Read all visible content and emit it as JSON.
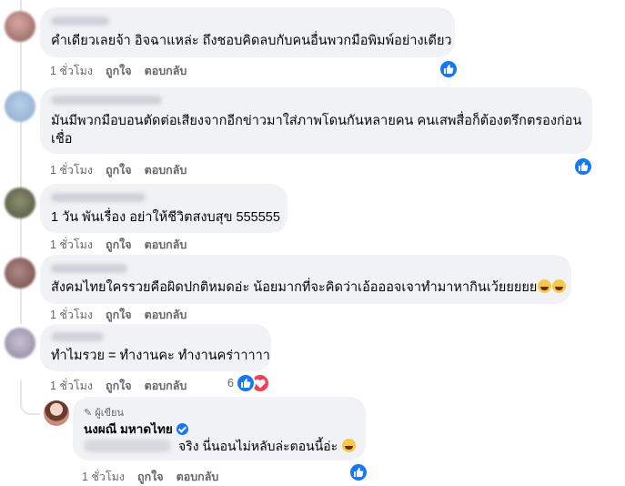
{
  "colors": {
    "bubble": "#f0f2f5",
    "meta_text": "#65676b",
    "like_blue": "#1877f2",
    "love_red": "#f33e58"
  },
  "comments": [
    {
      "text": "คำเดียวเลยจ้า อิจฉาแหล่ะ ถึงชอบคิดลบกับคนอื่นพวกมือพิมพ์อย่างเดียว",
      "time": "1 ชั่วโมง",
      "like": "ถูกใจ",
      "reply": "ตอบกลับ",
      "reaction_icon": "like-icon"
    },
    {
      "text_line1": "มันมีพวกมือบอนตัดต่อเสียงจากอีกข่าวมาใส่ภาพโดนกันหลายคน คนเสพสื่อก็ต้องตรึกตรองก่อน",
      "text_line2": "เชื่อ",
      "time": "1 ชั่วโมง",
      "like": "ถูกใจ",
      "reply": "ตอบกลับ",
      "reaction_icon": "like-icon"
    },
    {
      "text": "1 วัน พันเรื่อง อย่าให้ชีวิตสงบสุข 555555",
      "time": "1 ชั่วโมง",
      "like": "ถูกใจ",
      "reply": "ตอบกลับ"
    },
    {
      "text": "สังคมไทยใครรวยคือผิดปกติหมดอ่ะ น้อยมากที่จะคิดว่าเอ้อออจเจาทำมาหากินเว้ยยยยย",
      "emoji": "grinning-squinting-emoji",
      "time": "1 ชั่วโมง",
      "like": "ถูกใจ",
      "reply": "ตอบกลับ"
    },
    {
      "text": "ทำไมรวย = ทำงานคะ ทำงานคร่าาาาา",
      "time": "1 ชั่วโมง",
      "like": "ถูกใจ",
      "reply": "ตอบกลับ",
      "reaction_count": "6",
      "reaction_icons": [
        "like-icon",
        "love-icon"
      ]
    }
  ],
  "reply": {
    "badge": "ผู้เขียน",
    "badge_icon": "pencil-icon",
    "author": "นงผณี มหาดไทย",
    "verified_icon": "verified-badge-icon",
    "text": "จริง นี่นอนไม่หลับล่ะตอนนี้อ่ะ",
    "emoji": "rolling-laughing-emoji",
    "time": "1 ชั่วโมง",
    "like": "ถูกใจ",
    "reply": "ตอบกลับ",
    "reaction_icon": "like-icon"
  }
}
